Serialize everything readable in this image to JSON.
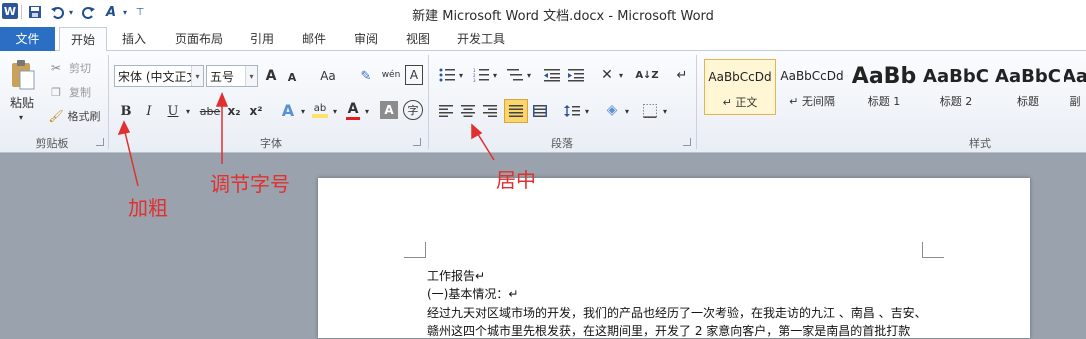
{
  "window": {
    "title": "新建 Microsoft Word 文档.docx - Microsoft Word"
  },
  "quick_access": {
    "app_icon": "W",
    "icons": [
      "save-icon",
      "undo-icon",
      "redo-icon",
      "spelling-icon",
      "customize-icon"
    ]
  },
  "tabs": [
    {
      "label": "文件"
    },
    {
      "label": "开始"
    },
    {
      "label": "插入"
    },
    {
      "label": "页面布局"
    },
    {
      "label": "引用"
    },
    {
      "label": "邮件"
    },
    {
      "label": "审阅"
    },
    {
      "label": "视图"
    },
    {
      "label": "开发工具"
    }
  ],
  "clipboard": {
    "paste_label": "粘贴",
    "cut_label": "剪切",
    "copy_label": "复制",
    "format_painter_label": "格式刷",
    "group_label": "剪贴板"
  },
  "font": {
    "font_name": "宋体 (中文正文",
    "font_size": "五号",
    "grow_label": "A",
    "shrink_label": "A",
    "case_label": "Aa",
    "bold_label": "B",
    "italic_label": "I",
    "underline_label": "U",
    "strike_label": "abe",
    "subscript_label": "x₂",
    "superscript_label": "x²",
    "phonetic_label": "wén",
    "group_label": "字体"
  },
  "paragraph": {
    "group_label": "段落"
  },
  "styles": {
    "items": [
      {
        "sample": "AaBbCcDd",
        "name": "↵ 正文"
      },
      {
        "sample": "AaBbCcDd",
        "name": "↵ 无间隔"
      },
      {
        "sample": "AaBb",
        "name": "标题 1"
      },
      {
        "sample": "AaBbC",
        "name": "标题 2"
      },
      {
        "sample": "AaBbC",
        "name": "标题"
      },
      {
        "sample": "Aa",
        "name": "副"
      }
    ],
    "group_label": "样式"
  },
  "annotations": {
    "bold": "加粗",
    "font_size": "调节字号",
    "center": "居中"
  },
  "document": {
    "lines": [
      "工作报告↵",
      "(一)基本情况：↵",
      "经过九天对区域市场的开发，我们的产品也经历了一次考验，在我走访的九江 、南昌 、吉安、",
      "赣州这四个城市里先根发获，在这期间里，开发了 2 家意向客户，第一家是南昌的首批打款"
    ]
  },
  "colors": {
    "accent": "#2b6fc4",
    "annotation": "#e03030",
    "highlight": "#ffe26b"
  }
}
